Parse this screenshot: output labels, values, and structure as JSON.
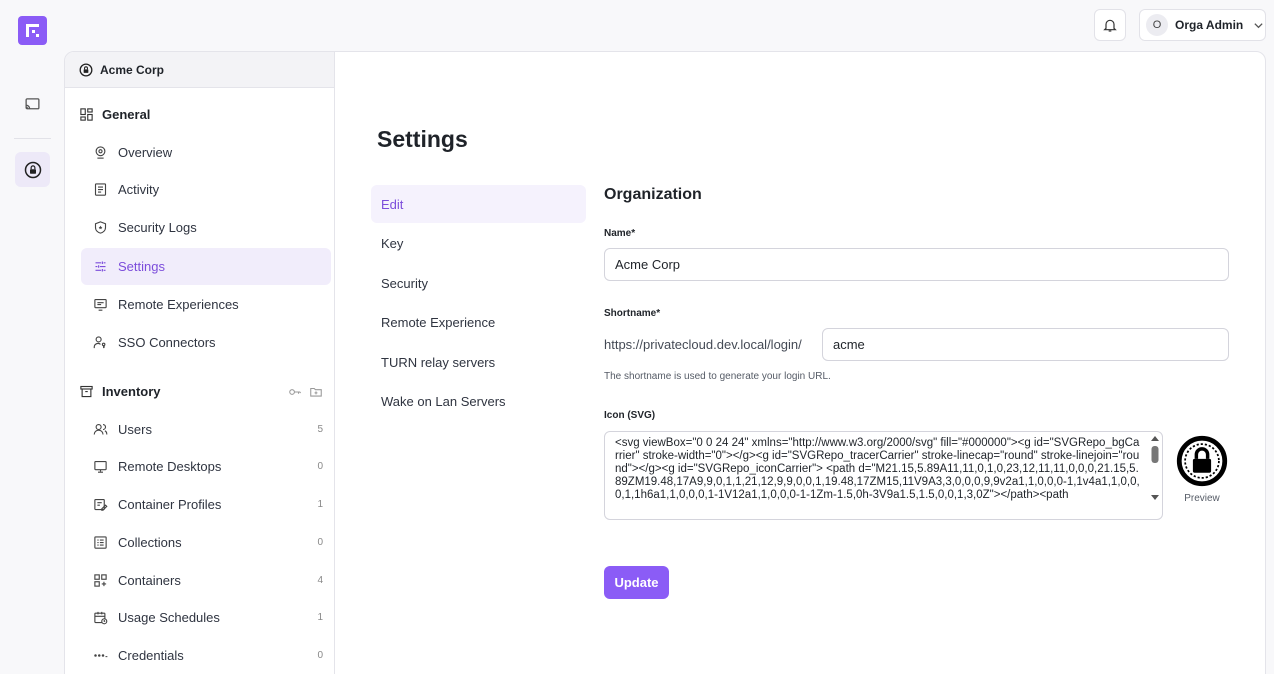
{
  "topbar": {
    "user_initial": "O",
    "user_name": "Orga Admin"
  },
  "sidebar": {
    "org_name": "Acme Corp",
    "general_title": "General",
    "general_items": [
      {
        "label": "Overview"
      },
      {
        "label": "Activity"
      },
      {
        "label": "Security Logs"
      },
      {
        "label": "Settings"
      },
      {
        "label": "Remote Experiences"
      },
      {
        "label": "SSO Connectors"
      }
    ],
    "inventory_title": "Inventory",
    "inventory_items": [
      {
        "label": "Users",
        "count": "5"
      },
      {
        "label": "Remote Desktops",
        "count": "0"
      },
      {
        "label": "Container Profiles",
        "count": "1"
      },
      {
        "label": "Collections",
        "count": "0"
      },
      {
        "label": "Containers",
        "count": "4"
      },
      {
        "label": "Usage Schedules",
        "count": "1"
      },
      {
        "label": "Credentials",
        "count": "0"
      }
    ]
  },
  "page": {
    "title": "Settings",
    "tabs": [
      {
        "label": "Edit"
      },
      {
        "label": "Key"
      },
      {
        "label": "Security"
      },
      {
        "label": "Remote Experience"
      },
      {
        "label": "TURN relay servers"
      },
      {
        "label": "Wake on Lan Servers"
      }
    ]
  },
  "form": {
    "title": "Organization",
    "name_label": "Name*",
    "name_value": "Acme Corp",
    "shortname_label": "Shortname*",
    "shortname_prefix": "https://privatecloud.dev.local/login/",
    "shortname_value": "acme",
    "shortname_help": "The shortname is used to generate your login URL.",
    "icon_label": "Icon (SVG)",
    "icon_value": "<svg viewBox=\"0 0 24 24\" xmlns=\"http://www.w3.org/2000/svg\" fill=\"#000000\"><g id=\"SVGRepo_bgCarrier\" stroke-width=\"0\"></g><g id=\"SVGRepo_tracerCarrier\" stroke-linecap=\"round\" stroke-linejoin=\"round\"></g><g id=\"SVGRepo_iconCarrier\"> <path d=\"M21.15,5.89A11,11,0,1,0,23,12,11,11,0,0,0,21.15,5.89ZM19.48,17A9,9,0,1,1,21,12,9,9,0,0,1,19.48,17ZM15,11V9A3,3,0,0,0,9,9v2a1,1,0,0,0-1,1v4a1,1,0,0,0,1,1h6a1,1,0,0,0,1-1V12a1,1,0,0,0-1-1Zm-1.5,0h-3V9a1.5,1.5,0,0,1,3,0Z\"></path><path",
    "preview_label": "Preview",
    "update_label": "Update"
  },
  "colors": {
    "accent": "#8b5cf6",
    "active_bg": "#f1edfb"
  }
}
